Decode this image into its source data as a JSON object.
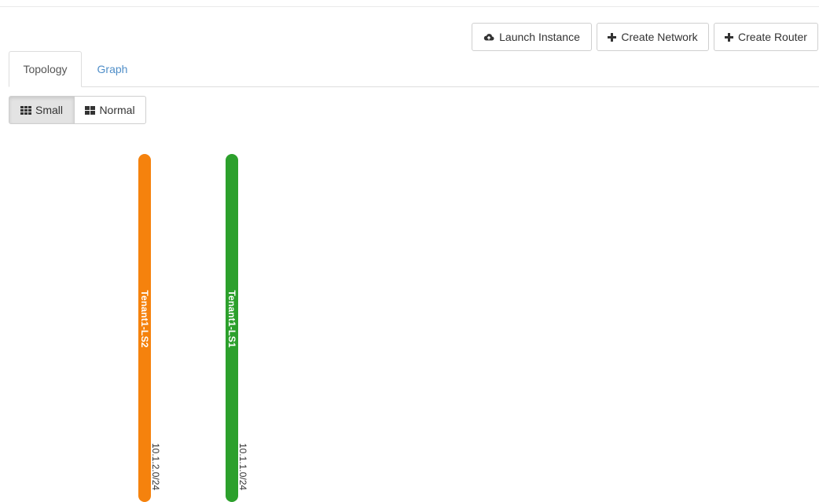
{
  "actions": {
    "launch_instance": "Launch Instance",
    "create_network": "Create Network",
    "create_router": "Create Router"
  },
  "tabs": [
    {
      "label": "Topology",
      "active": true
    },
    {
      "label": "Graph",
      "active": false
    }
  ],
  "size_toggle": {
    "small": "Small",
    "normal": "Normal",
    "selected": "Small"
  },
  "networks": [
    {
      "name": "Tenant1-LS2",
      "cidr": "10.1.2.0/24",
      "color": "#f5820d"
    },
    {
      "name": "Tenant1-LS1",
      "cidr": "10.1.1.0/24",
      "color": "#2ca02c"
    }
  ],
  "icons": {
    "launch": "cloud-upload-icon",
    "create_network": "plus-icon",
    "create_router": "plus-icon",
    "small": "th-icon",
    "normal": "th-large-icon"
  },
  "colors": {
    "link": "#4f8ec8",
    "active_toggle": "#e3e3e3"
  }
}
